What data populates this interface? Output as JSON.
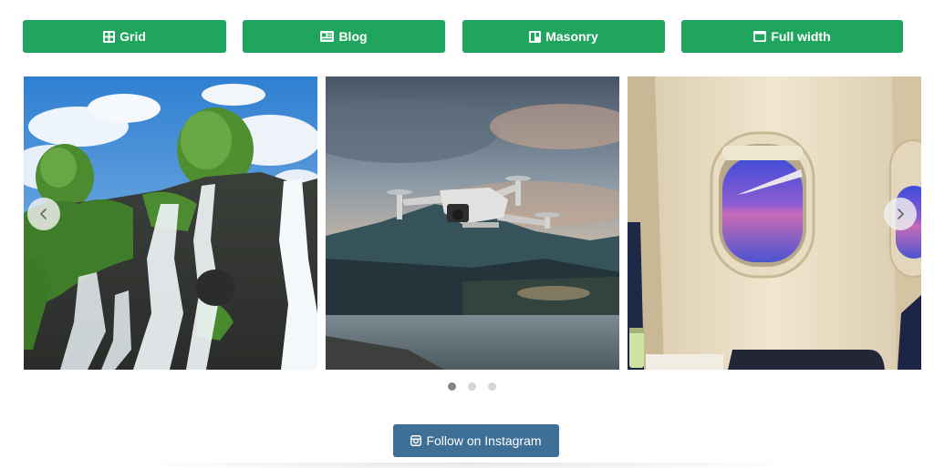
{
  "layout_tabs": {
    "grid": {
      "label": "Grid",
      "icon": "grid-icon"
    },
    "blog": {
      "label": "Blog",
      "icon": "blog-card-icon"
    },
    "masonry": {
      "label": "Masonry",
      "icon": "masonry-icon"
    },
    "full_width": {
      "label": "Full width",
      "icon": "full-width-icon"
    }
  },
  "carousel": {
    "slides": [
      {
        "subject": "waterfall"
      },
      {
        "subject": "drone"
      },
      {
        "subject": "airplane-window"
      }
    ],
    "prev_icon": "chevron-left-icon",
    "next_icon": "chevron-right-icon",
    "dots": [
      {
        "active": true
      },
      {
        "active": false
      },
      {
        "active": false
      }
    ]
  },
  "follow_button": {
    "label": "Follow on Instagram",
    "icon": "instagram-icon"
  },
  "colors": {
    "tab_green": "#1fa55e",
    "follow_blue": "#3d6f97",
    "dot_active": "#7c8a86",
    "dot_inactive": "#d6d6d6"
  }
}
